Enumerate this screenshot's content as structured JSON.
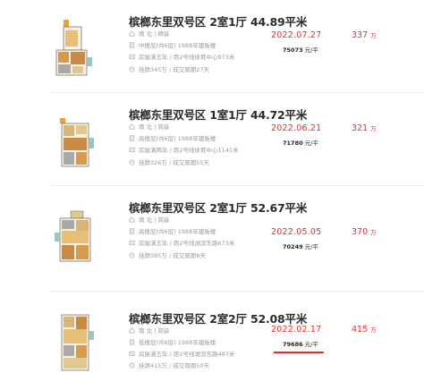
{
  "listings": [
    {
      "title": "槟榔东里双号区 2室1厅 44.89平米",
      "orientation": "南 北 | 精装",
      "floor": "中楼层(共6层) 1988年建板楼",
      "tags": "房屋满五年 / 距2号线体育中心973米",
      "listing": "挂牌345万 / 成交周期27天",
      "deal_date": "2022.07.27",
      "unit_price": "75073",
      "unit_price_suffix": "元/平",
      "total": "337",
      "total_unit": "万"
    },
    {
      "title": "槟榔东里双号区 1室1厅 44.72平米",
      "orientation": "南 北 | 简装",
      "floor": "高楼层(共6层) 1988年建板楼",
      "tags": "房屋满两年 / 距2号线体育中心1141米",
      "listing": "挂牌326万 / 成交周期55天",
      "deal_date": "2022.06.21",
      "unit_price": "71780",
      "unit_price_suffix": "元/平",
      "total": "321",
      "total_unit": "万"
    },
    {
      "title": "槟榔东里双号区 2室1厅 52.67平米",
      "orientation": "南 北 | 简装",
      "floor": "高楼层(共6层) 1988年建板楼",
      "tags": "房屋满五年 / 距2号线湖滨东路673米",
      "listing": "挂牌385万 / 成交周期8天",
      "deal_date": "2022.05.05",
      "unit_price": "70249",
      "unit_price_suffix": "元/平",
      "total": "370",
      "total_unit": "万"
    },
    {
      "title": "槟榔东里双号区 2室2厅 52.08平米",
      "orientation": "南 北 | 简装",
      "floor": "低楼层(共6层) 1988年建板楼",
      "tags": "房屋满五年 / 距2号线湖滨东路487米",
      "listing": "挂牌415万 / 成交周期50天",
      "deal_date": "2022.02.17",
      "unit_price": "79686",
      "unit_price_suffix": "元/平",
      "total": "415",
      "total_unit": "万"
    }
  ],
  "icons": {
    "orientation": "house-icon",
    "floor": "building-icon",
    "tags": "tag-icon",
    "listing": "clock-icon"
  },
  "colors": {
    "accent": "#e3302a",
    "title": "#2b2b2b",
    "meta": "#9a9a9a",
    "divider": "#ececec"
  }
}
